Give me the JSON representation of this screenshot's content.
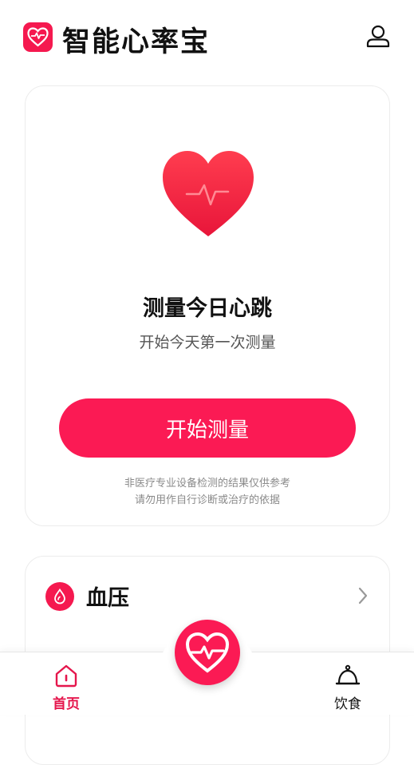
{
  "header": {
    "app_title": "智能心率宝",
    "logo_icon": "heart-pulse-icon",
    "profile_icon": "user-icon"
  },
  "measure_card": {
    "heart_icon": "heart-pulse-icon",
    "title": "测量今日心跳",
    "subtitle": "开始今天第一次测量",
    "start_button": "开始测量",
    "disclaimer_line1": "非医疗专业设备检测的结果仅供参考",
    "disclaimer_line2": "请勿用作自行诊断或治疗的依据"
  },
  "bp_card": {
    "icon": "blood-drop-icon",
    "title": "血压"
  },
  "tabbar": {
    "home_label": "首页",
    "diet_label": "饮食",
    "center_icon": "heart-pulse-icon"
  },
  "colors": {
    "accent": "#fb1a54",
    "tab_active": "#e5164c"
  }
}
